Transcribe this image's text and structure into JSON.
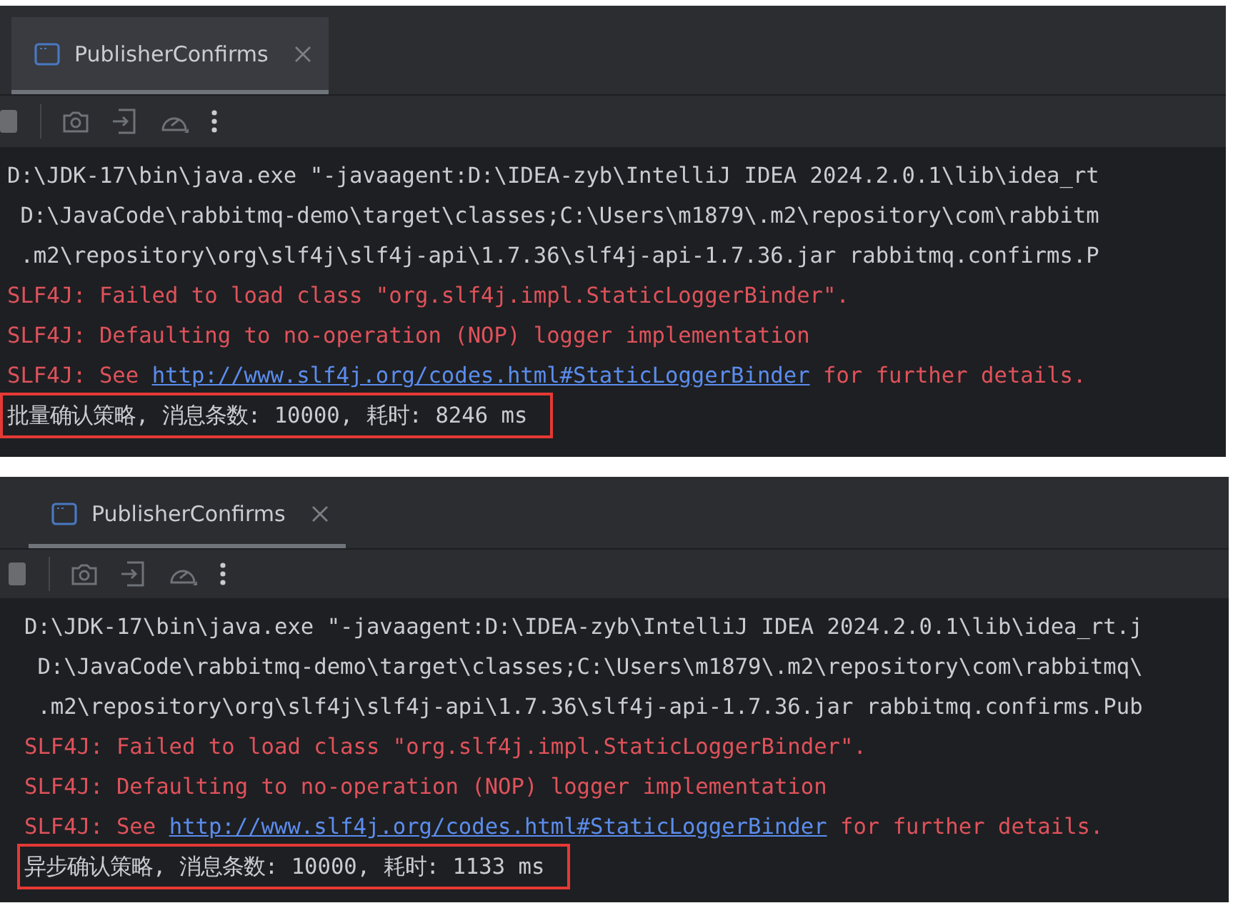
{
  "panels": [
    {
      "tab": {
        "label": "PublisherConfirms",
        "selected": true
      },
      "console": [
        {
          "kind": "command",
          "text": "D:\\JDK-17\\bin\\java.exe \"-javaagent:D:\\IDEA-zyb\\IntelliJ IDEA 2024.2.0.1\\lib\\idea_rt"
        },
        {
          "kind": "command",
          "text": " D:\\JavaCode\\rabbitmq-demo\\target\\classes;C:\\Users\\m1879\\.m2\\repository\\com\\rabbitm"
        },
        {
          "kind": "command",
          "text": " .m2\\repository\\org\\slf4j\\slf4j-api\\1.7.36\\slf4j-api-1.7.36.jar rabbitmq.confirms.P"
        },
        {
          "kind": "error",
          "text": "SLF4J: Failed to load class \"org.slf4j.impl.StaticLoggerBinder\"."
        },
        {
          "kind": "error",
          "text": "SLF4J: Defaulting to no-operation (NOP) logger implementation"
        },
        {
          "kind": "error",
          "text": "SLF4J: See ",
          "link": "http://www.slf4j.org/codes.html#StaticLoggerBinder",
          "after": " for further details."
        },
        {
          "kind": "result",
          "text": "批量确认策略, 消息条数: 10000, 耗时: 8246 ms",
          "highlighted": true
        }
      ]
    },
    {
      "tab": {
        "label": "PublisherConfirms",
        "selected": true
      },
      "console": [
        {
          "kind": "command",
          "text": "D:\\JDK-17\\bin\\java.exe \"-javaagent:D:\\IDEA-zyb\\IntelliJ IDEA 2024.2.0.1\\lib\\idea_rt.j"
        },
        {
          "kind": "command",
          "text": " D:\\JavaCode\\rabbitmq-demo\\target\\classes;C:\\Users\\m1879\\.m2\\repository\\com\\rabbitmq\\"
        },
        {
          "kind": "command",
          "text": " .m2\\repository\\org\\slf4j\\slf4j-api\\1.7.36\\slf4j-api-1.7.36.jar rabbitmq.confirms.Pub"
        },
        {
          "kind": "error",
          "text": "SLF4J: Failed to load class \"org.slf4j.impl.StaticLoggerBinder\"."
        },
        {
          "kind": "error",
          "text": "SLF4J: Defaulting to no-operation (NOP) logger implementation"
        },
        {
          "kind": "error",
          "text": "SLF4J: See ",
          "link": "http://www.slf4j.org/codes.html#StaticLoggerBinder",
          "after": " for further details."
        },
        {
          "kind": "result",
          "text": "异步确认策略, 消息条数: 10000, 耗时: 1133 ms",
          "highlighted": true
        }
      ]
    }
  ]
}
